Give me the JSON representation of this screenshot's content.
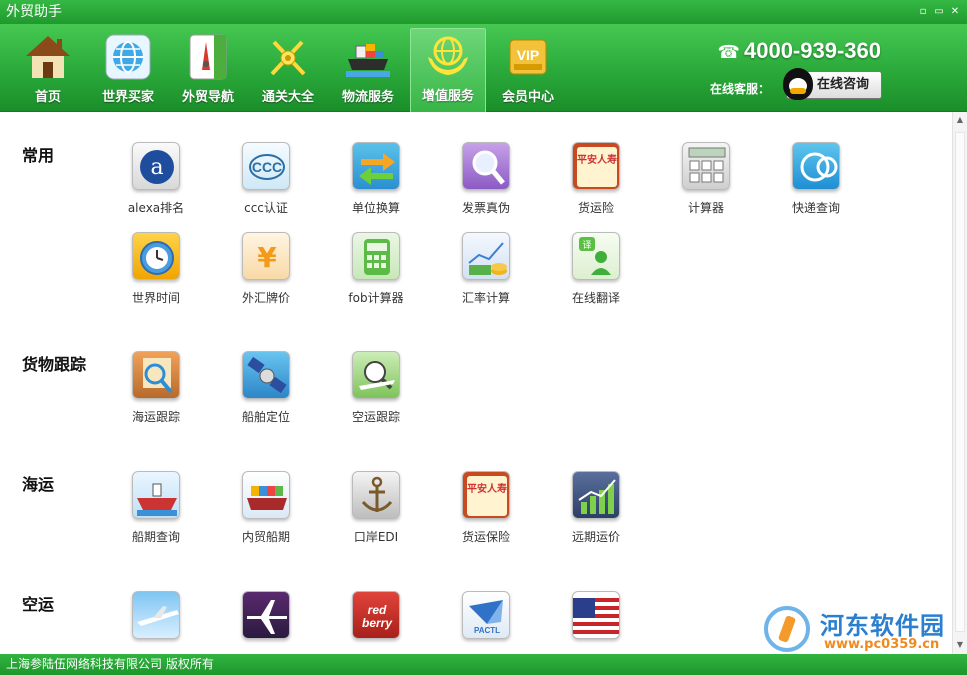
{
  "window": {
    "title": "外贸助手",
    "controls": [
      "▫",
      "▭",
      "✕"
    ]
  },
  "nav": {
    "items": [
      {
        "label": "首页",
        "icon": "home-icon"
      },
      {
        "label": "世界买家",
        "icon": "globe-icon"
      },
      {
        "label": "外贸导航",
        "icon": "compass-icon"
      },
      {
        "label": "通关大全",
        "icon": "customs-icon"
      },
      {
        "label": "物流服务",
        "icon": "ship-icon"
      },
      {
        "label": "增值服务",
        "icon": "globe-hands-icon",
        "active": true
      },
      {
        "label": "会员中心",
        "icon": "vip-icon"
      }
    ],
    "phone": "4000-939-360",
    "online_label": "在线客服：",
    "consult_button": "在线咨询"
  },
  "sections": [
    {
      "title": "常用",
      "tools": [
        {
          "label": "alexa排名",
          "icon": "alexa-icon"
        },
        {
          "label": "ccc认证",
          "icon": "ccc-icon"
        },
        {
          "label": "单位换算",
          "icon": "convert-arrows-icon"
        },
        {
          "label": "发票真伪",
          "icon": "magnifier-icon"
        },
        {
          "label": "货运险",
          "icon": "insurance-icon",
          "text": "平安人寿"
        },
        {
          "label": "计算器",
          "icon": "calculator-icon"
        },
        {
          "label": "快递查询",
          "icon": "express-icon"
        },
        {
          "label": "世界时间",
          "icon": "alarm-clock-icon"
        },
        {
          "label": "外汇牌价",
          "icon": "yen-icon"
        },
        {
          "label": "fob计算器",
          "icon": "fob-calculator-icon"
        },
        {
          "label": "汇率计算",
          "icon": "exchange-chart-icon"
        },
        {
          "label": "在线翻译",
          "icon": "translate-person-icon",
          "text": "译"
        }
      ]
    },
    {
      "title": "货物跟踪",
      "tools": [
        {
          "label": "海运跟踪",
          "icon": "sea-track-icon"
        },
        {
          "label": "船舶定位",
          "icon": "satellite-icon"
        },
        {
          "label": "空运跟踪",
          "icon": "air-track-icon"
        }
      ]
    },
    {
      "title": "海运",
      "tools": [
        {
          "label": "船期查询",
          "icon": "ship-schedule-icon"
        },
        {
          "label": "内贸船期",
          "icon": "container-ship-icon"
        },
        {
          "label": "口岸EDI",
          "icon": "anchor-icon"
        },
        {
          "label": "货运保险",
          "icon": "insurance-icon",
          "text": "平安人寿"
        },
        {
          "label": "远期运价",
          "icon": "rising-chart-icon"
        }
      ]
    },
    {
      "title": "空运",
      "tools": [
        {
          "label": "",
          "icon": "airplane-icon"
        },
        {
          "label": "",
          "icon": "airplane-dark-icon"
        },
        {
          "label": "",
          "icon": "redberry-icon",
          "text": "red berry"
        },
        {
          "label": "",
          "icon": "pactl-icon",
          "text": "PACTL"
        },
        {
          "label": "",
          "icon": "us-flag-icon"
        }
      ]
    }
  ],
  "statusbar": {
    "copyright": "上海参陆伍网络科技有限公司 版权所有"
  },
  "watermark": {
    "name": "河东软件园",
    "url": "www.pc0359.cn"
  },
  "colors": {
    "title_green": "#1f9a2d",
    "nav_green": "#2aa93a",
    "watermark_blue": "#2a7fcf",
    "watermark_orange": "#f08a1e"
  }
}
